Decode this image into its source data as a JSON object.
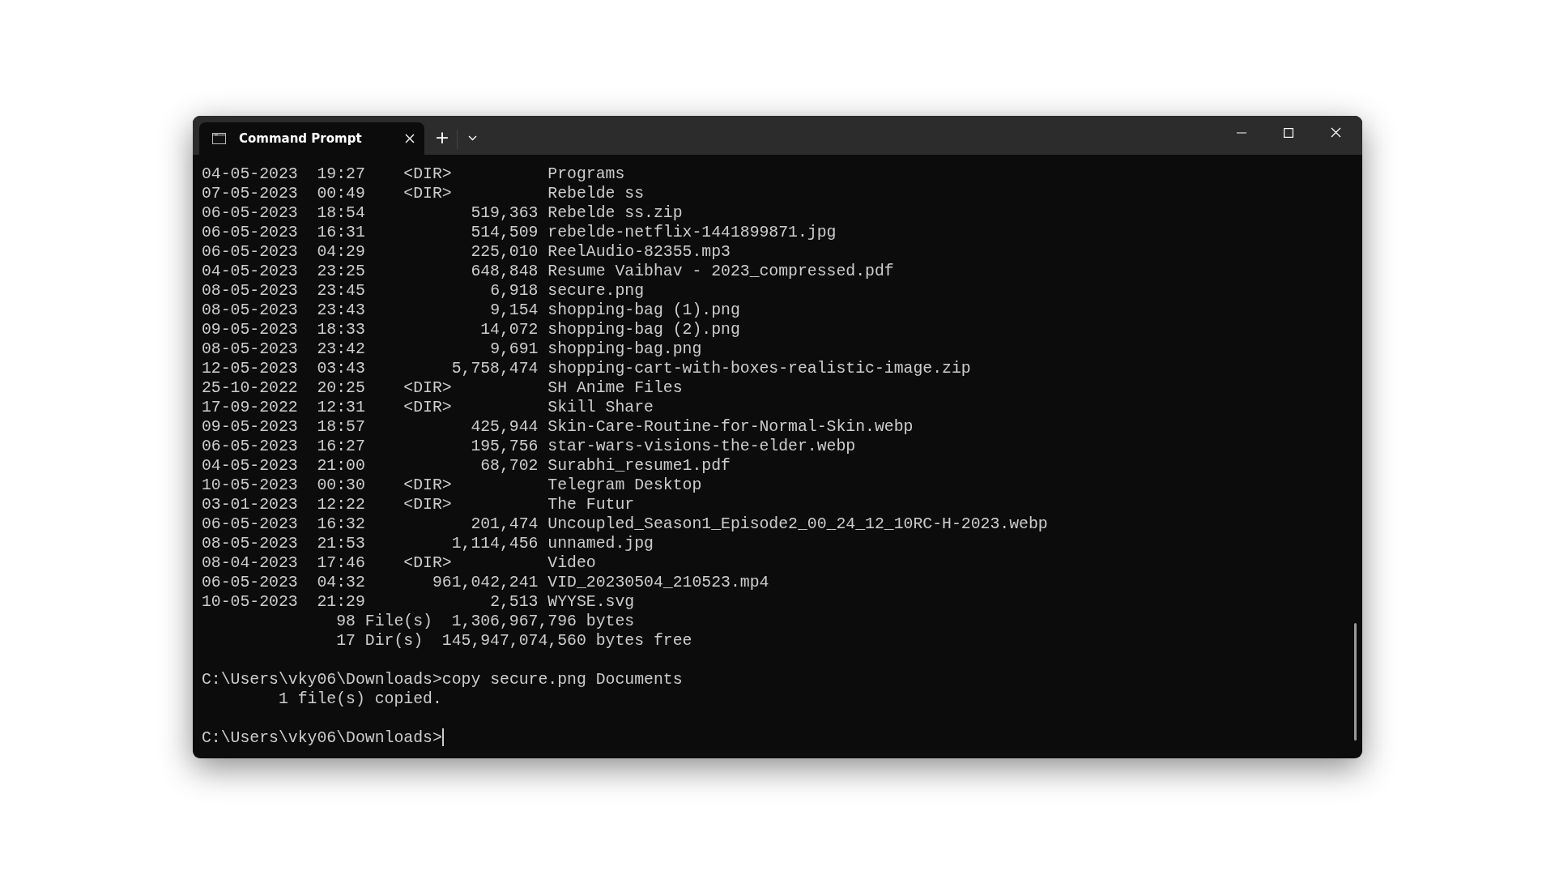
{
  "window": {
    "tab_title": "Command Prompt",
    "new_tab": "+"
  },
  "listing": [
    {
      "date": "04-05-2023",
      "time": "19:27",
      "kind": "dir",
      "size": "<DIR>",
      "name": "Programs"
    },
    {
      "date": "07-05-2023",
      "time": "00:49",
      "kind": "dir",
      "size": "<DIR>",
      "name": "Rebelde ss"
    },
    {
      "date": "06-05-2023",
      "time": "18:54",
      "kind": "file",
      "size": "519,363",
      "name": "Rebelde ss.zip"
    },
    {
      "date": "06-05-2023",
      "time": "16:31",
      "kind": "file",
      "size": "514,509",
      "name": "rebelde-netflix-1441899871.jpg"
    },
    {
      "date": "06-05-2023",
      "time": "04:29",
      "kind": "file",
      "size": "225,010",
      "name": "ReelAudio-82355.mp3"
    },
    {
      "date": "04-05-2023",
      "time": "23:25",
      "kind": "file",
      "size": "648,848",
      "name": "Resume Vaibhav - 2023_compressed.pdf"
    },
    {
      "date": "08-05-2023",
      "time": "23:45",
      "kind": "file",
      "size": "6,918",
      "name": "secure.png"
    },
    {
      "date": "08-05-2023",
      "time": "23:43",
      "kind": "file",
      "size": "9,154",
      "name": "shopping-bag (1).png"
    },
    {
      "date": "09-05-2023",
      "time": "18:33",
      "kind": "file",
      "size": "14,072",
      "name": "shopping-bag (2).png"
    },
    {
      "date": "08-05-2023",
      "time": "23:42",
      "kind": "file",
      "size": "9,691",
      "name": "shopping-bag.png"
    },
    {
      "date": "12-05-2023",
      "time": "03:43",
      "kind": "file",
      "size": "5,758,474",
      "name": "shopping-cart-with-boxes-realistic-image.zip"
    },
    {
      "date": "25-10-2022",
      "time": "20:25",
      "kind": "dir",
      "size": "<DIR>",
      "name": "SH Anime Files"
    },
    {
      "date": "17-09-2022",
      "time": "12:31",
      "kind": "dir",
      "size": "<DIR>",
      "name": "Skill Share"
    },
    {
      "date": "09-05-2023",
      "time": "18:57",
      "kind": "file",
      "size": "425,944",
      "name": "Skin-Care-Routine-for-Normal-Skin.webp"
    },
    {
      "date": "06-05-2023",
      "time": "16:27",
      "kind": "file",
      "size": "195,756",
      "name": "star-wars-visions-the-elder.webp"
    },
    {
      "date": "04-05-2023",
      "time": "21:00",
      "kind": "file",
      "size": "68,702",
      "name": "Surabhi_resume1.pdf"
    },
    {
      "date": "10-05-2023",
      "time": "00:30",
      "kind": "dir",
      "size": "<DIR>",
      "name": "Telegram Desktop"
    },
    {
      "date": "03-01-2023",
      "time": "12:22",
      "kind": "dir",
      "size": "<DIR>",
      "name": "The Futur"
    },
    {
      "date": "06-05-2023",
      "time": "16:32",
      "kind": "file",
      "size": "201,474",
      "name": "Uncoupled_Season1_Episode2_00_24_12_10RC-H-2023.webp"
    },
    {
      "date": "08-05-2023",
      "time": "21:53",
      "kind": "file",
      "size": "1,114,456",
      "name": "unnamed.jpg"
    },
    {
      "date": "08-04-2023",
      "time": "17:46",
      "kind": "dir",
      "size": "<DIR>",
      "name": "Video"
    },
    {
      "date": "06-05-2023",
      "time": "04:32",
      "kind": "file",
      "size": "961,042,241",
      "name": "VID_20230504_210523.mp4"
    },
    {
      "date": "10-05-2023",
      "time": "21:29",
      "kind": "file",
      "size": "2,513",
      "name": "WYYSE.svg"
    }
  ],
  "summary": [
    {
      "count": "98 File(s)",
      "amount": "1,306,967,796 bytes"
    },
    {
      "count": "17 Dir(s)",
      "amount": "145,947,074,560 bytes free"
    }
  ],
  "session": [
    {
      "kind": "command",
      "prompt": "C:\\Users\\vky06\\Downloads>",
      "input": "copy secure.png Documents"
    },
    {
      "kind": "output",
      "text": "1 file(s) copied."
    },
    {
      "kind": "blank"
    },
    {
      "kind": "prompt",
      "prompt": "C:\\Users\\vky06\\Downloads>",
      "cursor": true
    }
  ]
}
